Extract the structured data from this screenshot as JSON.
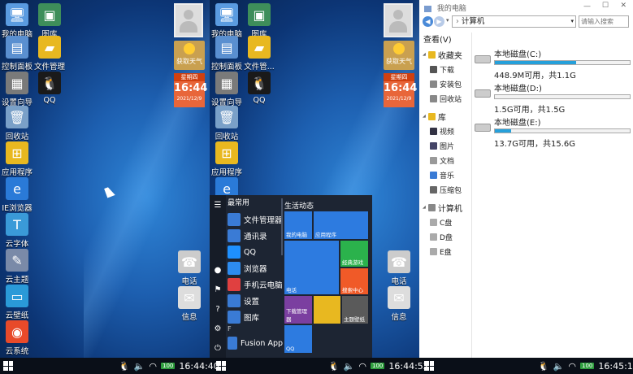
{
  "panel1": {
    "icons": [
      {
        "label": "我的电脑",
        "icon": "computer-icon"
      },
      {
        "label": "图库",
        "icon": "gallery-icon"
      },
      {
        "label": "控制面板",
        "icon": "control-panel-icon"
      },
      {
        "label": "文件管理",
        "icon": "folder-icon"
      },
      {
        "label": "设置向导",
        "icon": "settings-wizard-icon"
      },
      {
        "label": "QQ",
        "icon": "qq-icon"
      },
      {
        "label": "回收站",
        "icon": "recycle-bin-icon"
      },
      {
        "label": "应用程序",
        "icon": "windows-apps-icon"
      },
      {
        "label": "IE浏览器",
        "icon": "ie-icon"
      },
      {
        "label": "云字体",
        "icon": "font-icon"
      },
      {
        "label": "云主题",
        "icon": "theme-icon"
      },
      {
        "label": "云壁纸",
        "icon": "wallpaper-icon"
      },
      {
        "label": "云系统",
        "icon": "cloud-system-icon"
      }
    ],
    "weather_label": "获取天气",
    "clock": {
      "weekday": "星期四",
      "time": "16:44",
      "date": "2021/12/9"
    },
    "right_icons": [
      {
        "label": "电话",
        "icon": "phone-icon"
      },
      {
        "label": "信息",
        "icon": "message-icon"
      }
    ]
  },
  "panel2": {
    "icons": [
      {
        "label": "我的电脑"
      },
      {
        "label": "图库"
      },
      {
        "label": "控制面板"
      },
      {
        "label": "文件管..."
      },
      {
        "label": "设置向导"
      },
      {
        "label": "QQ"
      },
      {
        "label": "回收站"
      },
      {
        "label": "应用程序"
      },
      {
        "label": "IE浏览器"
      },
      {
        "label": "云"
      }
    ],
    "weather_label": "获取天气",
    "clock": {
      "weekday": "星期四",
      "time": "16:44",
      "date": "2021/12/9"
    },
    "right_icons": [
      {
        "label": "电话"
      },
      {
        "label": "信息"
      }
    ],
    "start_menu": {
      "section_title": "最常用",
      "items": [
        {
          "label": "文件管理器",
          "color": "#3a7bd5"
        },
        {
          "label": "通讯录",
          "color": "#3a7bd5"
        },
        {
          "label": "QQ",
          "color": "#1e90ff"
        },
        {
          "label": "浏览器",
          "color": "#2d8cf0"
        },
        {
          "label": "手机云电脑",
          "color": "#e04040"
        },
        {
          "label": "设置",
          "color": "#3a7bd5"
        },
        {
          "label": "图库",
          "color": "#3a7bd5"
        },
        {
          "label": "Fusion App",
          "color": "#3a7bd5"
        }
      ],
      "letter": "F",
      "tiles_title": "生活动态",
      "tiles": [
        {
          "label": "我的电脑",
          "color": "#2d7be0"
        },
        {
          "label": "应用程序",
          "color": "#2d7be0"
        },
        {
          "label": "电话",
          "color": "#2d7be0"
        },
        {
          "label": "经典游戏",
          "color": "#2bb24c"
        },
        {
          "label": "搜索中心",
          "color": "#f05a28"
        },
        {
          "label": "下载管理器",
          "color": "#7b3fa0"
        },
        {
          "label": "",
          "color": "#e8b820"
        },
        {
          "label": "主题壁纸",
          "color": "#5a5a5a"
        },
        {
          "label": "QQ",
          "color": "#2d7be0"
        }
      ]
    }
  },
  "explorer": {
    "title": "我的电脑",
    "address": "计算机",
    "search_placeholder": "请输入搜索",
    "menu": "查看(V)",
    "sidebar": [
      {
        "label": "收藏夹",
        "type": "group",
        "color": "#e8b820"
      },
      {
        "label": "下载",
        "type": "item",
        "color": "#555"
      },
      {
        "label": "安装包",
        "type": "item",
        "color": "#888"
      },
      {
        "label": "回收站",
        "type": "item",
        "color": "#888"
      },
      {
        "label": "库",
        "type": "group",
        "color": "#e8b820"
      },
      {
        "label": "视频",
        "type": "item",
        "color": "#334"
      },
      {
        "label": "图片",
        "type": "item",
        "color": "#446"
      },
      {
        "label": "文档",
        "type": "item",
        "color": "#999"
      },
      {
        "label": "音乐",
        "type": "item",
        "color": "#3a7bd5"
      },
      {
        "label": "压缩包",
        "type": "item",
        "color": "#666"
      },
      {
        "label": "计算机",
        "type": "group",
        "color": "#888"
      },
      {
        "label": "C盘",
        "type": "item",
        "color": "#aaa"
      },
      {
        "label": "D盘",
        "type": "item",
        "color": "#aaa"
      },
      {
        "label": "E盘",
        "type": "item",
        "color": "#aaa"
      }
    ],
    "drives": [
      {
        "name": "本地磁盘(C:)",
        "info": "448.9M可用，共1.1G",
        "used_fraction": 0.6
      },
      {
        "name": "本地磁盘(D:)",
        "info": "1.5G可用，共1.5G",
        "used_fraction": 0.0
      },
      {
        "name": "本地磁盘(E:)",
        "info": "13.7G可用，共15.6G",
        "used_fraction": 0.12
      }
    ]
  },
  "taskbar": {
    "time1": "16:44:40",
    "time2": "16:44:52",
    "time3": "16:45:12",
    "battery": "100"
  }
}
